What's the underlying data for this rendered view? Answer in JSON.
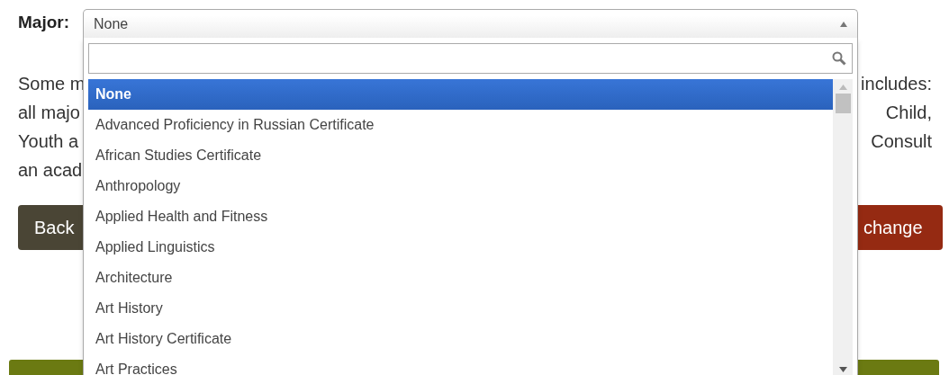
{
  "field": {
    "label": "Major:",
    "value": "None",
    "expanded": true
  },
  "paragraph": [
    {
      "left": "Some m",
      "right": "includes:"
    },
    {
      "left": "all majo",
      "right": "Child,"
    },
    {
      "left": "Youth a",
      "right": "Consult"
    },
    {
      "left": "an acad"
    }
  ],
  "buttons": [
    {
      "label": "Back",
      "kind": "back"
    },
    {
      "label": "change",
      "kind": "danger"
    }
  ],
  "dropdown": {
    "options": [
      {
        "label": "None",
        "selected": true
      },
      {
        "label": "Advanced Proficiency in Russian Certificate",
        "selected": false
      },
      {
        "label": "African Studies Certificate",
        "selected": false
      },
      {
        "label": "Anthropology",
        "selected": false
      },
      {
        "label": "Applied Health and Fitness",
        "selected": false
      },
      {
        "label": "Applied Linguistics",
        "selected": false
      },
      {
        "label": "Architecture",
        "selected": false
      },
      {
        "label": "Art History",
        "selected": false
      },
      {
        "label": "Art History Certificate",
        "selected": false
      },
      {
        "label": "Art Practices",
        "selected": false
      }
    ]
  }
}
